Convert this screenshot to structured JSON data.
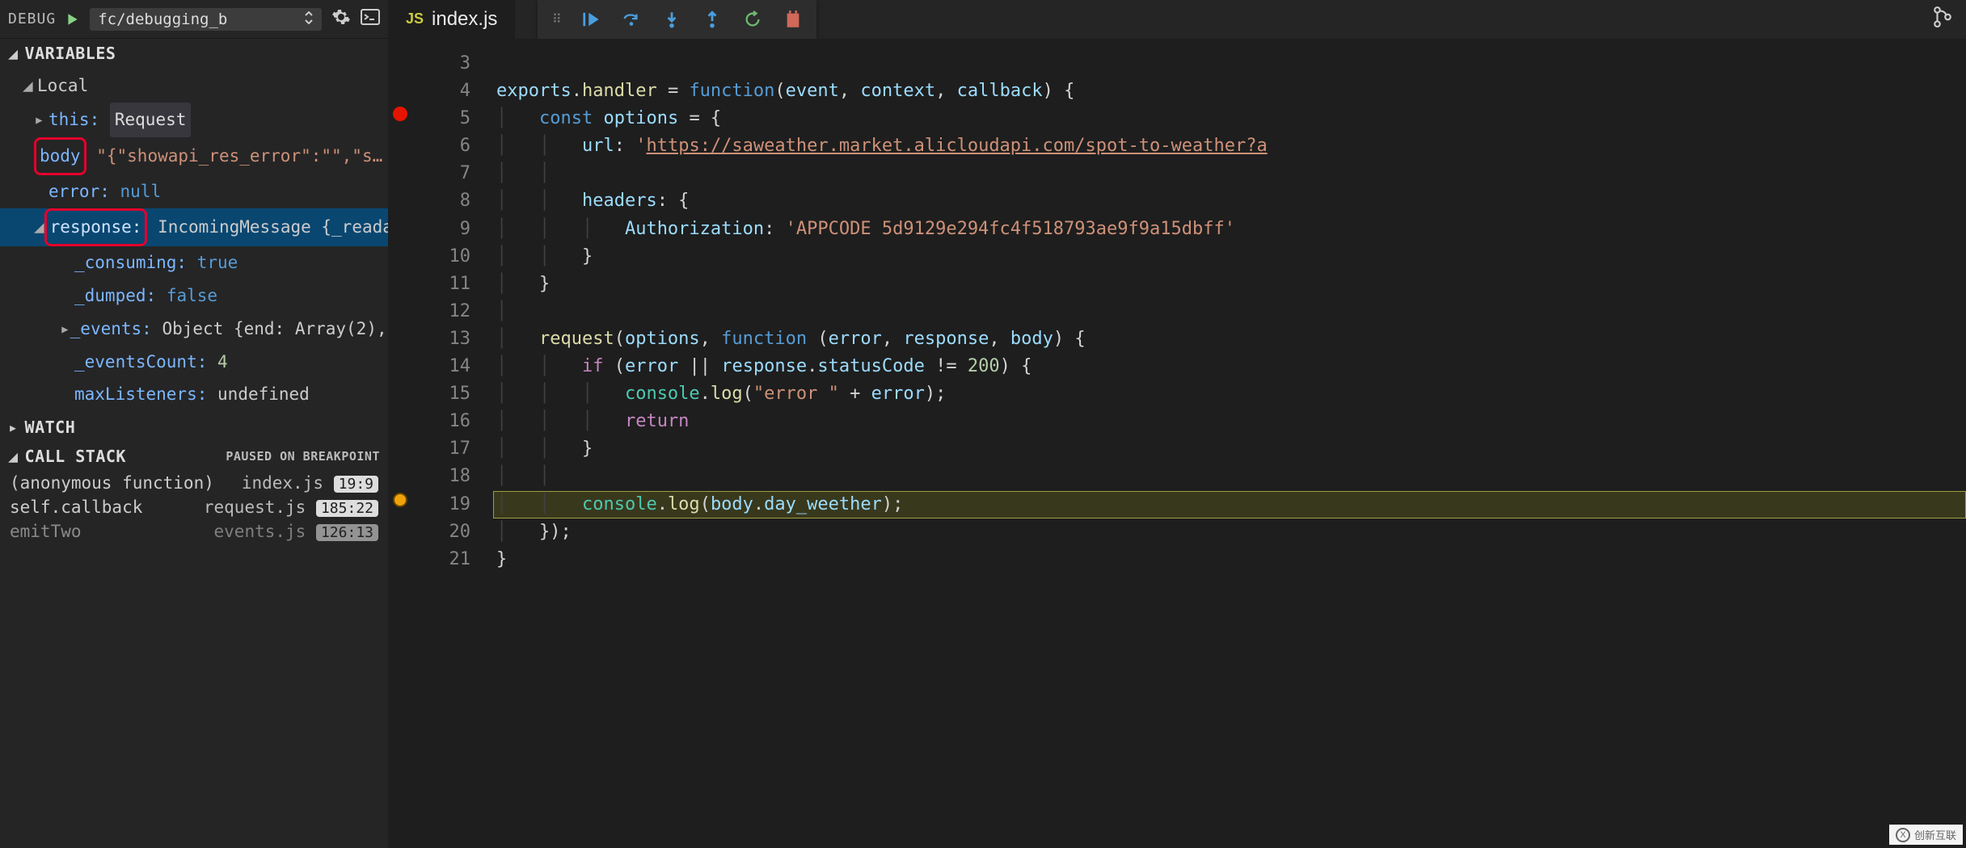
{
  "topbar": {
    "label": "DEBUG",
    "config": "fc/debugging_b",
    "file_tab": {
      "badge": "JS",
      "name": "index.js"
    }
  },
  "variables": {
    "section": "VARIABLES",
    "scope": "Local",
    "items": {
      "this": {
        "key": "this:",
        "val": "Request"
      },
      "body": {
        "key": "body",
        "val": "\"{\"showapi_res_error\":\"\",\"s…"
      },
      "error": {
        "key": "error:",
        "val": "null"
      },
      "response": {
        "key": "response:",
        "val": "IncomingMessage {_reada…"
      },
      "c1": {
        "key": "_consuming:",
        "val": "true"
      },
      "c2": {
        "key": "_dumped:",
        "val": "false"
      },
      "c3": {
        "key": "_events:",
        "val": "Object {end: Array(2), …"
      },
      "c4": {
        "key": "_eventsCount:",
        "val": "4"
      },
      "c5": {
        "key": "maxListeners:",
        "val": "undefined"
      }
    }
  },
  "watch": {
    "section": "WATCH"
  },
  "callstack": {
    "section": "CALL STACK",
    "status": "PAUSED ON BREAKPOINT",
    "frames": [
      {
        "fn": "(anonymous function)",
        "file": "index.js",
        "pos": "19:9"
      },
      {
        "fn": "self.callback",
        "file": "request.js",
        "pos": "185:22"
      },
      {
        "fn": "emitTwo",
        "file": "events.js",
        "pos": "126:13"
      }
    ]
  },
  "editor": {
    "lines": [
      3,
      4,
      5,
      6,
      7,
      8,
      9,
      10,
      11,
      12,
      13,
      14,
      15,
      16,
      17,
      18,
      19,
      20,
      21
    ],
    "breakpoints": {
      "5": "red",
      "19": "yellow"
    },
    "url": "https://saweather.market.alicloudapi.com/spot-to-weather?a",
    "appcode": "APPCODE 5d9129e294fc4f518793ae9f9a15dbff"
  },
  "watermark": "创新互联"
}
